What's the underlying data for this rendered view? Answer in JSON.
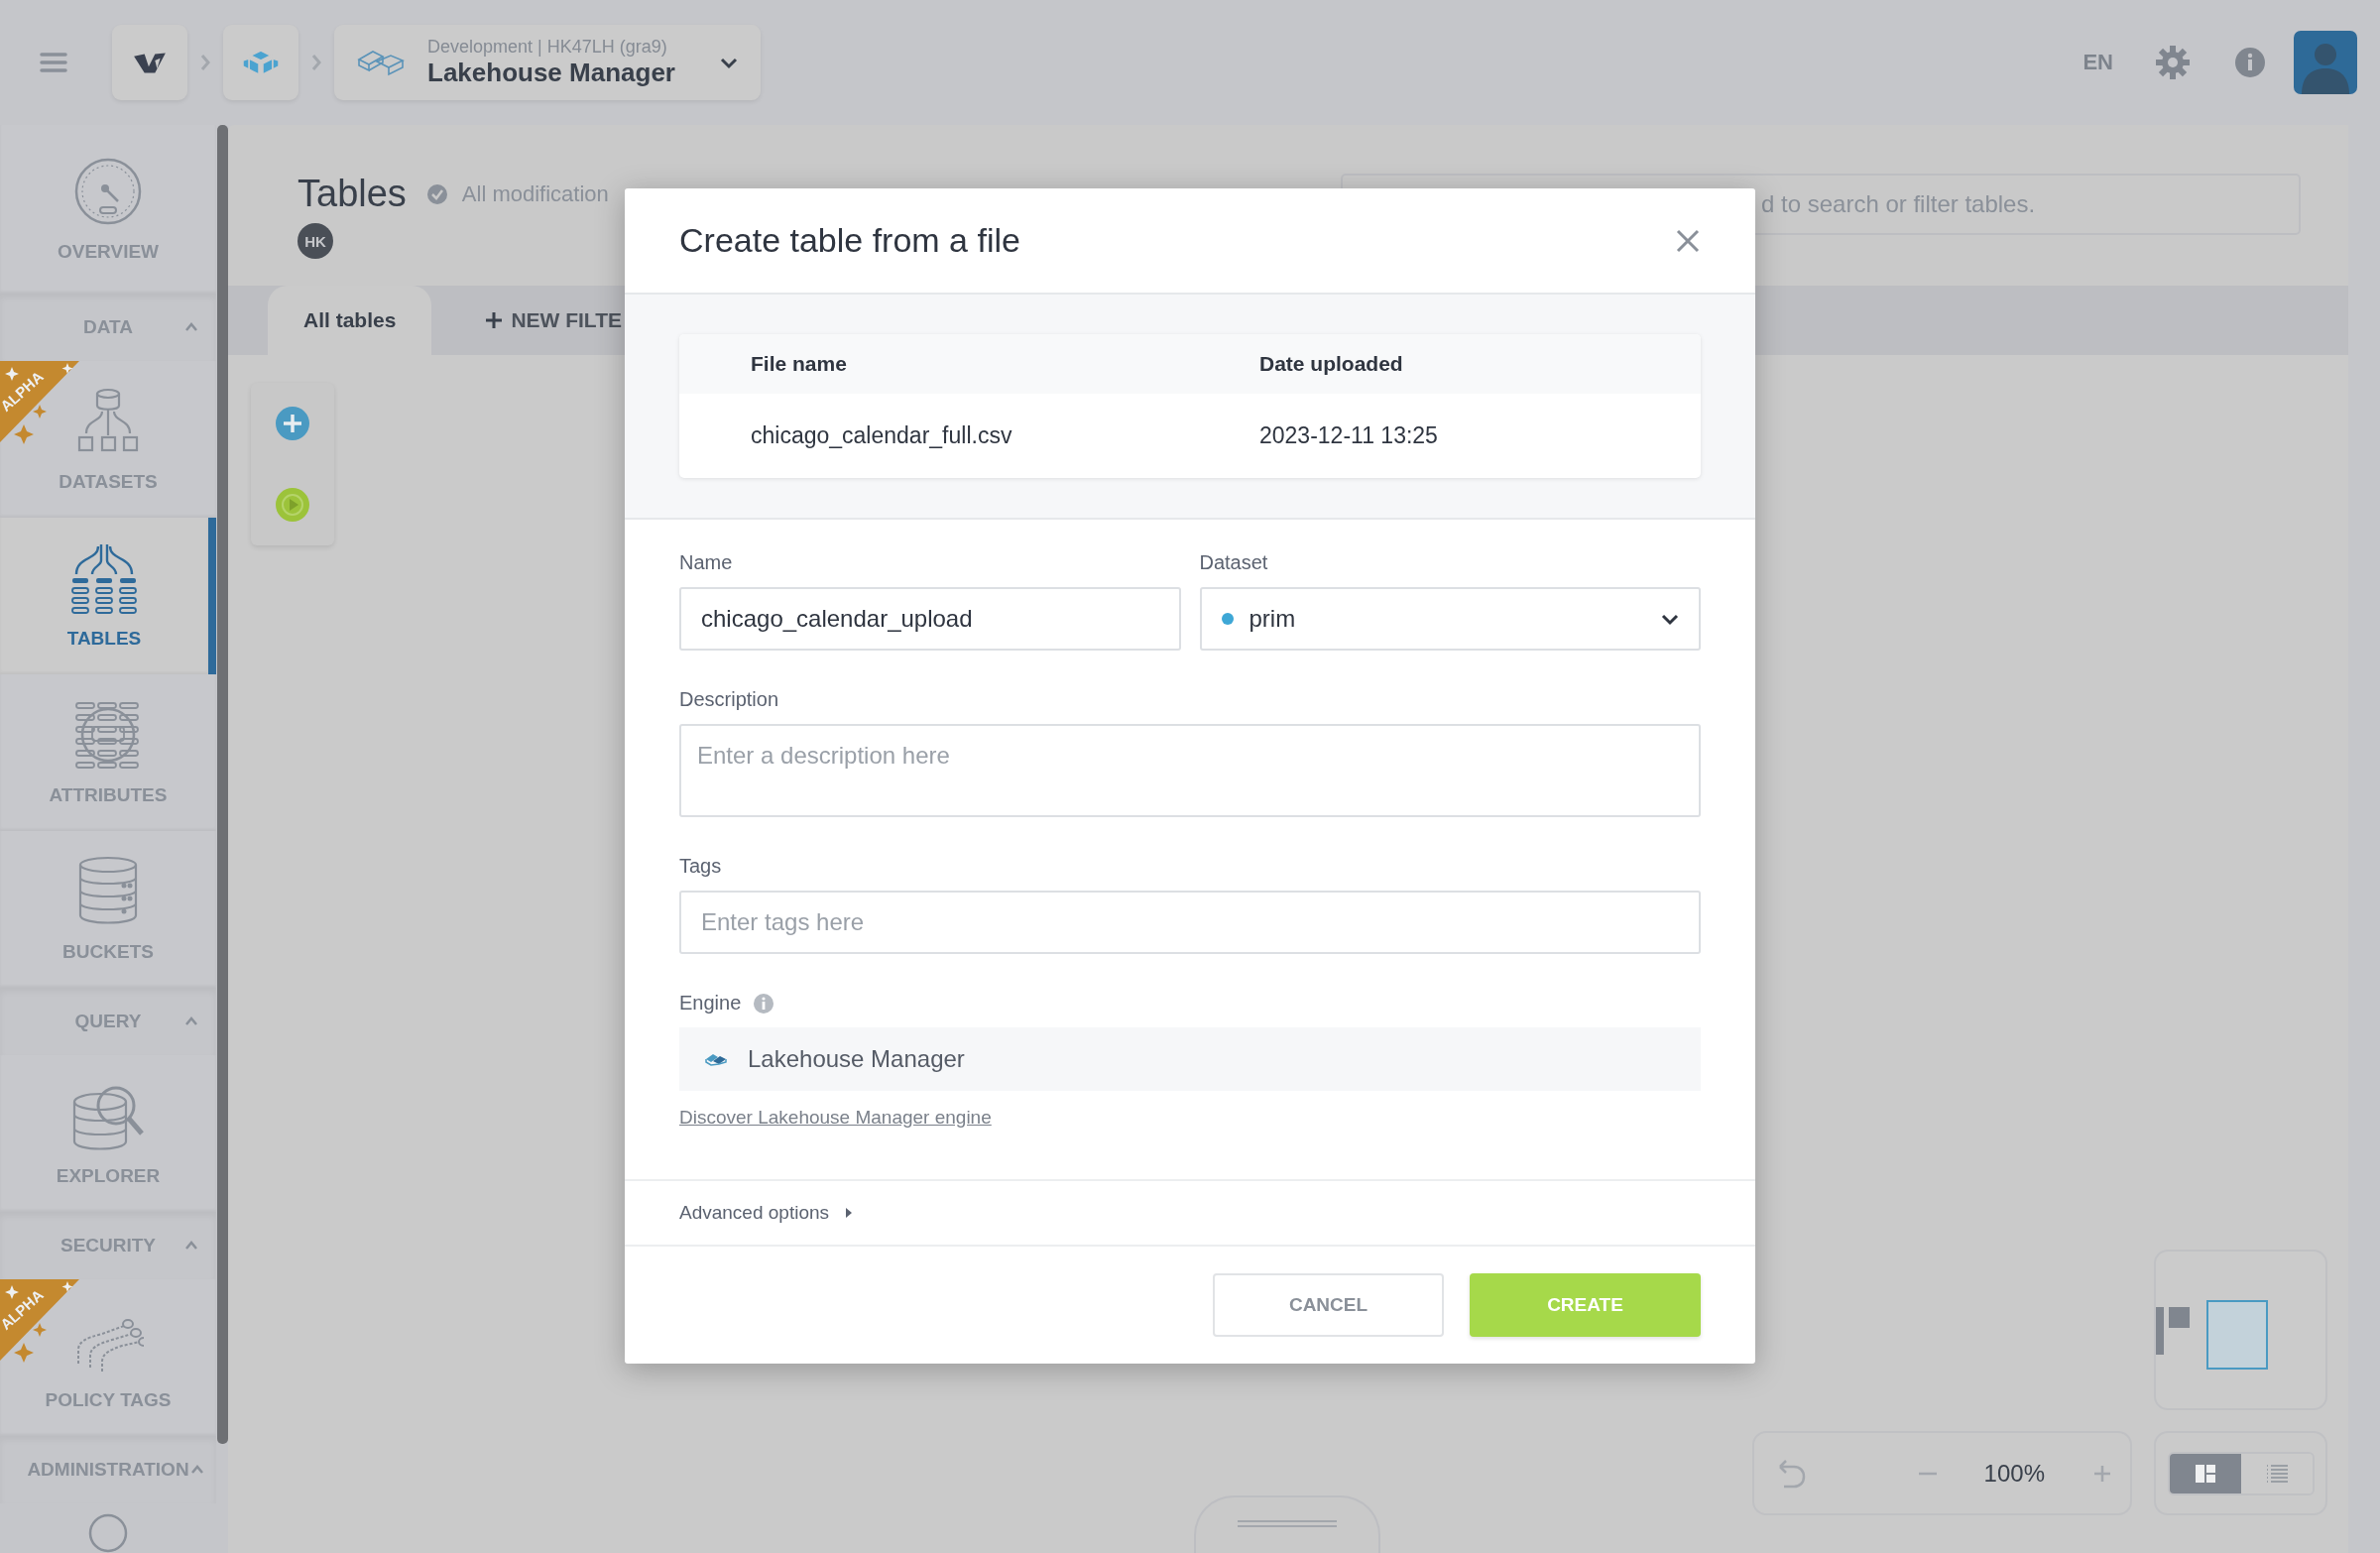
{
  "top_bar": {
    "breadcrumb": {
      "subtitle": "Development | HK47LH (gra9)",
      "title": "Lakehouse Manager"
    },
    "language": "EN"
  },
  "sidebar": {
    "items": [
      {
        "kind": "item",
        "label": "OVERVIEW",
        "selected": false
      },
      {
        "kind": "section",
        "label": "DATA",
        "expanded": true
      },
      {
        "kind": "item",
        "label": "DATASETS",
        "selected": false,
        "badge": "ALPHA"
      },
      {
        "kind": "item",
        "label": "TABLES",
        "selected": true
      },
      {
        "kind": "item",
        "label": "ATTRIBUTES",
        "selected": false
      },
      {
        "kind": "item",
        "label": "BUCKETS",
        "selected": false
      },
      {
        "kind": "section",
        "label": "QUERY",
        "expanded": true
      },
      {
        "kind": "item",
        "label": "EXPLORER",
        "selected": false
      },
      {
        "kind": "section",
        "label": "SECURITY",
        "expanded": true
      },
      {
        "kind": "item",
        "label": "POLICY TAGS",
        "selected": false,
        "badge": "ALPHA"
      },
      {
        "kind": "section",
        "label": "ADMINISTRATION",
        "expanded": true
      }
    ]
  },
  "page": {
    "title": "Tables",
    "save_status": "All modification",
    "owner_initials": "HK",
    "search": {
      "placeholder": "d to search or filter tables."
    },
    "tabs": [
      {
        "label": "All tables",
        "selected": true
      },
      {
        "label": "NEW FILTE",
        "selected": false
      }
    ]
  },
  "canvas": {
    "zoom": "100%",
    "view_modes": [
      {
        "kind": "diagram",
        "selected": true
      },
      {
        "kind": "list",
        "selected": false
      }
    ]
  },
  "dialog": {
    "title": "Create table from a file",
    "files": {
      "columns": [
        "File name",
        "Date uploaded"
      ],
      "rows": [
        [
          "chicago_calendar_full.csv",
          "2023-12-11 13:25"
        ]
      ]
    },
    "name": {
      "label": "Name",
      "value": "chicago_calendar_upload"
    },
    "dataset": {
      "label": "Dataset",
      "value": "prim",
      "color": "#3ea7d6"
    },
    "description": {
      "label": "Description",
      "placeholder": "Enter a description here"
    },
    "tags": {
      "label": "Tags",
      "placeholder": "Enter tags here"
    },
    "engine": {
      "label": "Engine",
      "value": "Lakehouse Manager"
    },
    "link": "Discover Lakehouse Manager engine",
    "advanced": {
      "label": "Advanced options",
      "expanded": false
    },
    "buttons": {
      "cancel": "CANCEL",
      "create": "CREATE"
    }
  }
}
